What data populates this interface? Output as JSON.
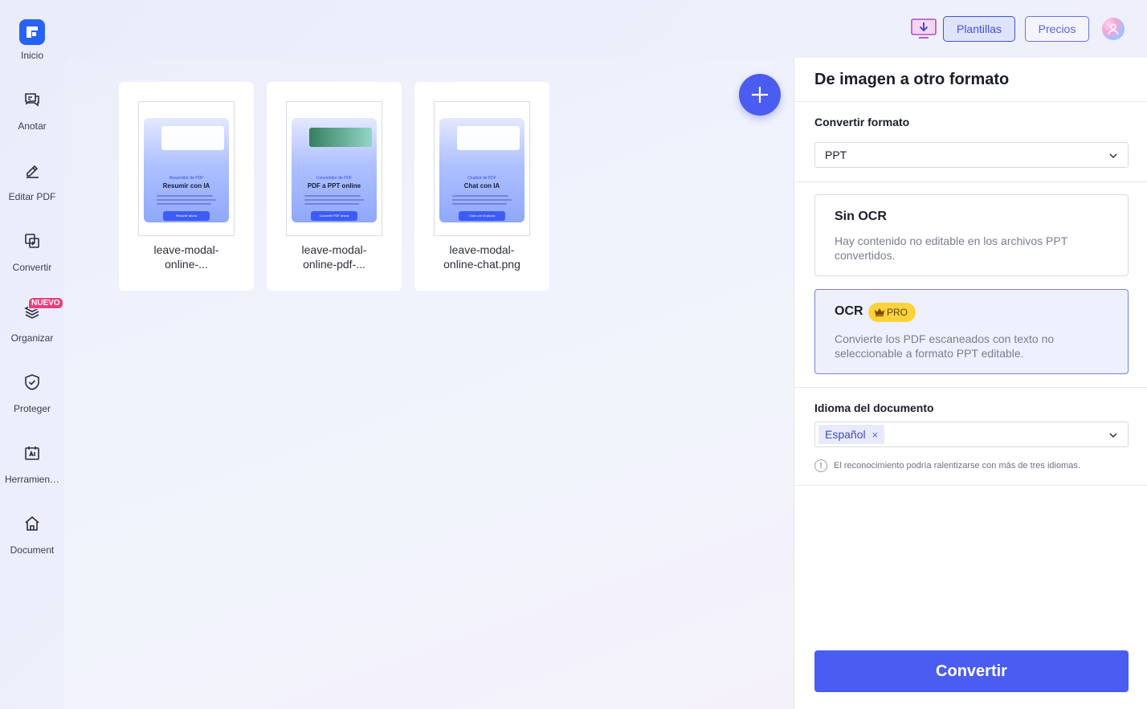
{
  "sidebar": {
    "items": [
      {
        "label": "Inicio",
        "icon": "logo-icon"
      },
      {
        "label": "Anotar",
        "icon": "annotate-icon"
      },
      {
        "label": "Editar PDF",
        "icon": "edit-icon"
      },
      {
        "label": "Convertir",
        "icon": "convert-icon"
      },
      {
        "label": "Organizar",
        "icon": "layers-icon",
        "badge": "NUEVO"
      },
      {
        "label": "Proteger",
        "icon": "shield-icon"
      },
      {
        "label": "Herramien…",
        "icon": "tools-icon"
      },
      {
        "label": "Document",
        "icon": "home-icon"
      }
    ]
  },
  "topbar": {
    "plantillas": "Plantillas",
    "precios": "Precios"
  },
  "files": [
    {
      "name_line1": "leave-modal-",
      "name_line2": "online-...",
      "thumb_small": "Resumidor de PDF",
      "thumb_title": "Resumir con IA",
      "thumb_button": "Resumir ahora"
    },
    {
      "name_line1": "leave-modal-",
      "name_line2": "online-pdf-...",
      "thumb_small": "Convertidor de PDF",
      "thumb_title": "PDF a PPT online",
      "thumb_button": "Convertir PDF ahora"
    },
    {
      "name_line1": "leave-modal-",
      "name_line2": "online-chat.png",
      "thumb_small": "Chatbot de PDF",
      "thumb_title": "Chat con IA",
      "thumb_button": "Chat con IA ahora"
    }
  ],
  "panel": {
    "title": "De imagen a otro formato",
    "format_label": "Convertir formato",
    "format_value": "PPT",
    "options": [
      {
        "title": "Sin OCR",
        "desc": "Hay contenido no editable en los archivos PPT convertidos.",
        "selected": false
      },
      {
        "title": "OCR",
        "badge": "PRO",
        "desc": "Convierte los PDF escaneados con texto no seleccionable a formato PPT editable.",
        "selected": true
      }
    ],
    "language_label": "Idioma del documento",
    "language_tag": "Español",
    "hint": "El reconocimiento podría ralentizarse con más de tres idiomas.",
    "convert": "Convertir"
  },
  "colors": {
    "accent": "#4b5cf0",
    "badge": "#ef3e7d",
    "pro": "#fcd23c"
  }
}
